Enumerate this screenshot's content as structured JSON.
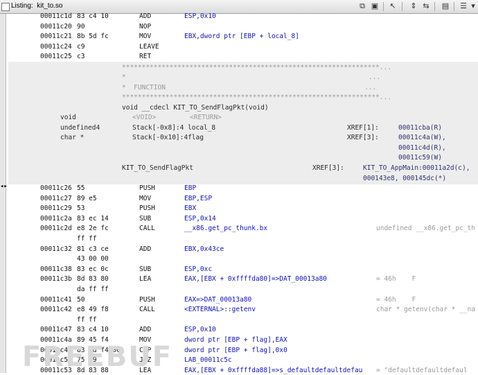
{
  "title": "Listing:  kit_to.so",
  "toolbar_icons": [
    "copy-icon",
    "paste-icon",
    "cursor-icon",
    "navigate-icon",
    "diff-icon",
    "snapshot-icon",
    "options-icon"
  ],
  "code_lines_top": [
    {
      "addr": "00011c1d",
      "bytes": "83 c4 10",
      "mn": "ADD",
      "op": "ESP,0x10"
    },
    {
      "addr": "00011c20",
      "bytes": "90",
      "mn": "NOP",
      "op": ""
    },
    {
      "addr": "00011c21",
      "bytes": "8b 5d fc",
      "mn": "MOV",
      "op": "EBX,dword ptr [EBP + local_8]"
    },
    {
      "addr": "00011c24",
      "bytes": "c9",
      "mn": "LEAVE",
      "op": ""
    },
    {
      "addr": "00011c25",
      "bytes": "c3",
      "mn": "RET",
      "op": ""
    }
  ],
  "function_header": {
    "stars1": "*****************************************************************...",
    "star2": "*",
    "dots2": "...",
    "func_label": "*  FUNCTION",
    "dots3": "...",
    "stars4": "*****************************************************************...",
    "signature": "void __cdecl KIT_TO_SendFlagPkt(void)",
    "ret_type": "void",
    "ret_void": "<VOID>",
    "ret_return": "<RETURN>",
    "var1_type": "undefined4",
    "var1_loc": "Stack[-0x8]:4 local_8",
    "var1_xref": "XREF[1]:",
    "var1_ref1": "00011cba(R)",
    "var2_type": "char *",
    "var2_loc": "Stack[-0x10]:4flag",
    "var2_xref": "XREF[3]:",
    "var2_ref1": "00011c4a(W),",
    "var2_ref2": "00011c4d(R),",
    "var2_ref3": "00011c59(W)",
    "label": "KIT_TO_SendFlagPkt",
    "label_xref": "XREF[3]:",
    "label_ref1": "KIT_TO_AppMain:00011a2d(c),",
    "label_ref2": "000143e8, 000145dc(*)"
  },
  "code_lines_bottom": [
    {
      "addr": "00011c26",
      "bytes": "55",
      "mn": "PUSH",
      "op": "EBP",
      "cm": ""
    },
    {
      "addr": "00011c27",
      "bytes": "89 e5",
      "mn": "MOV",
      "op": "EBP,ESP",
      "cm": ""
    },
    {
      "addr": "00011c29",
      "bytes": "53",
      "mn": "PUSH",
      "op": "EBX",
      "cm": ""
    },
    {
      "addr": "00011c2a",
      "bytes": "83 ec 14",
      "mn": "SUB",
      "op": "ESP,0x14",
      "cm": ""
    },
    {
      "addr": "00011c2d",
      "bytes": "e8 2e fc",
      "mn": "CALL",
      "op": "__x86.get_pc_thunk.bx",
      "cm": "undefined __x86.get_pc_th"
    },
    {
      "addr": "",
      "bytes": "ff ff",
      "mn": "",
      "op": "",
      "cm": ""
    },
    {
      "addr": "00011c32",
      "bytes": "81 c3 ce",
      "mn": "ADD",
      "op": "EBX,0x43ce",
      "cm": ""
    },
    {
      "addr": "",
      "bytes": "43 00 00",
      "mn": "",
      "op": "",
      "cm": ""
    },
    {
      "addr": "00011c38",
      "bytes": "83 ec 0c",
      "mn": "SUB",
      "op": "ESP,0xc",
      "cm": ""
    },
    {
      "addr": "00011c3b",
      "bytes": "8d 83 80",
      "mn": "LEA",
      "op": "EAX,[EBX + 0xffffda80]=>DAT_00013a80",
      "cm": "= 46h    F"
    },
    {
      "addr": "",
      "bytes": "da ff ff",
      "mn": "",
      "op": "",
      "cm": ""
    },
    {
      "addr": "00011c41",
      "bytes": "50",
      "mn": "PUSH",
      "op": "EAX=>DAT_00013a80",
      "cm": "= 46h    F"
    },
    {
      "addr": "00011c42",
      "bytes": "e8 49 f8",
      "mn": "CALL",
      "op": "<EXTERNAL>::getenv",
      "cm": "char * getenv(char * __na"
    },
    {
      "addr": "",
      "bytes": "ff ff",
      "mn": "",
      "op": "",
      "cm": ""
    },
    {
      "addr": "00011c47",
      "bytes": "83 c4 10",
      "mn": "ADD",
      "op": "ESP,0x10",
      "cm": ""
    },
    {
      "addr": "00011c4a",
      "bytes": "89 45 f4",
      "mn": "MOV",
      "op": "dword ptr [EBP + flag],EAX",
      "cm": ""
    },
    {
      "addr": "00011c4d",
      "bytes": "83 7d f4 00",
      "mn": "CMP",
      "op": "dword ptr [EBP + flag],0x0",
      "cm": ""
    },
    {
      "addr": "00011c51",
      "bytes": "75 09",
      "mn": "JNZ",
      "op": "LAB_00011c5c",
      "cm": ""
    },
    {
      "addr": "00011c53",
      "bytes": "8d 83 88",
      "mn": "LEA",
      "op": "EAX,[EBX + 0xffffda88]=>s_defaultdefaultdefau",
      "cm": "= \"defaultdefaultdefaul"
    }
  ],
  "watermark": "FREEBUF"
}
